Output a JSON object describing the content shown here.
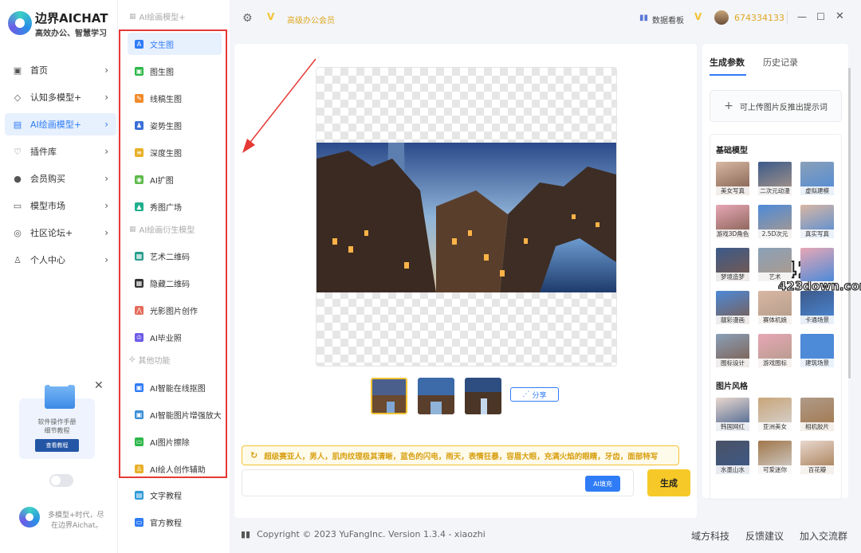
{
  "app": {
    "title": "边界AICHAT",
    "subtitle": "高效办公、智慧学习"
  },
  "nav": [
    {
      "label": "首页",
      "icon": "home-icon"
    },
    {
      "label": "认知多模型+",
      "icon": "cube-icon"
    },
    {
      "label": "AI绘画模型+",
      "icon": "image-icon",
      "active": true
    },
    {
      "label": "插件库",
      "icon": "plugin-icon"
    },
    {
      "label": "会员购买",
      "icon": "user-icon"
    },
    {
      "label": "模型市场",
      "icon": "store-icon"
    },
    {
      "label": "社区论坛+",
      "icon": "chat-icon"
    },
    {
      "label": "个人中心",
      "icon": "person-icon"
    }
  ],
  "promo": {
    "line1": "软件操作手册",
    "line2": "细节教程",
    "button": "查看教程"
  },
  "sidebar_footer": {
    "line1": "多模型+时代，尽",
    "line2": "在边界Aichat。"
  },
  "submenu": {
    "section1": "AI绘画模型+",
    "section2": "AI绘画衍生模型",
    "section3": "其他功能",
    "items": [
      {
        "label": "文生图",
        "color": "#2f7cf6",
        "active": true
      },
      {
        "label": "图生图",
        "color": "#2eb84a"
      },
      {
        "label": "线稿生图",
        "color": "#f08a2b"
      },
      {
        "label": "姿势生图",
        "color": "#3b6fd8"
      },
      {
        "label": "深度生图",
        "color": "#e8b12a"
      },
      {
        "label": "AI扩图",
        "color": "#5cba4a"
      },
      {
        "label": "秀图广场",
        "color": "#1fae8e"
      },
      {
        "label": "艺术二维码",
        "color": "#2a9d8f"
      },
      {
        "label": "隐藏二维码",
        "color": "#333333"
      },
      {
        "label": "光影图片创作",
        "color": "#e46b5a"
      },
      {
        "label": "AI毕业照",
        "color": "#6c5ce7"
      },
      {
        "label": "AI智能在线抠图",
        "color": "#2f7cf6"
      },
      {
        "label": "AI智能图片增强放大",
        "color": "#3b8fd8"
      },
      {
        "label": "AI图片擦除",
        "color": "#2eb84a"
      },
      {
        "label": "AI绘人创作辅助",
        "color": "#e8b12a"
      },
      {
        "label": "文字教程",
        "color": "#2f9bd8"
      },
      {
        "label": "官方教程",
        "color": "#2f7cf6"
      }
    ]
  },
  "topbar": {
    "vip": "高级办公会员",
    "dashboard": "数据看板",
    "uid": "674334133"
  },
  "main": {
    "share": "分享",
    "prompt": "超级赛亚人，男人，肌肉纹理极其清晰，蓝色的闪电，雨天，表情狂暴，容眉大眼，充满火焰的眼睛，牙齿，面部特写",
    "fill_button": "AI填充",
    "generate_button": "生成"
  },
  "footer": {
    "copyright": "Copyright © 2023 YuFangInc. Version 1.3.4 - xiaozhi",
    "link1": "域方科技",
    "link2": "反馈建议",
    "link3": "加入交流群"
  },
  "right": {
    "tab1": "生成参数",
    "tab2": "历史记录",
    "upload": "可上传图片反推出提示词",
    "section_base": "基础模型",
    "base_models": [
      "美女写真",
      "二次元动漫",
      "虚拟建模",
      "游戏3D角色",
      "2.5D次元",
      "真实写真",
      "梦境造梦",
      "艺术",
      "",
      "靓彩漫画",
      "赛体机娘",
      "卡通场景",
      "图标设计",
      "游戏图标",
      "建筑场景"
    ],
    "section_style": "图片风格",
    "style_models": [
      "韩国网红",
      "亚洲美女",
      "相机胶片",
      "水墨山水",
      "可爱迷你",
      "百花瓣"
    ]
  },
  "watermark": {
    "line1": "423",
    "line2": "423down.com"
  }
}
